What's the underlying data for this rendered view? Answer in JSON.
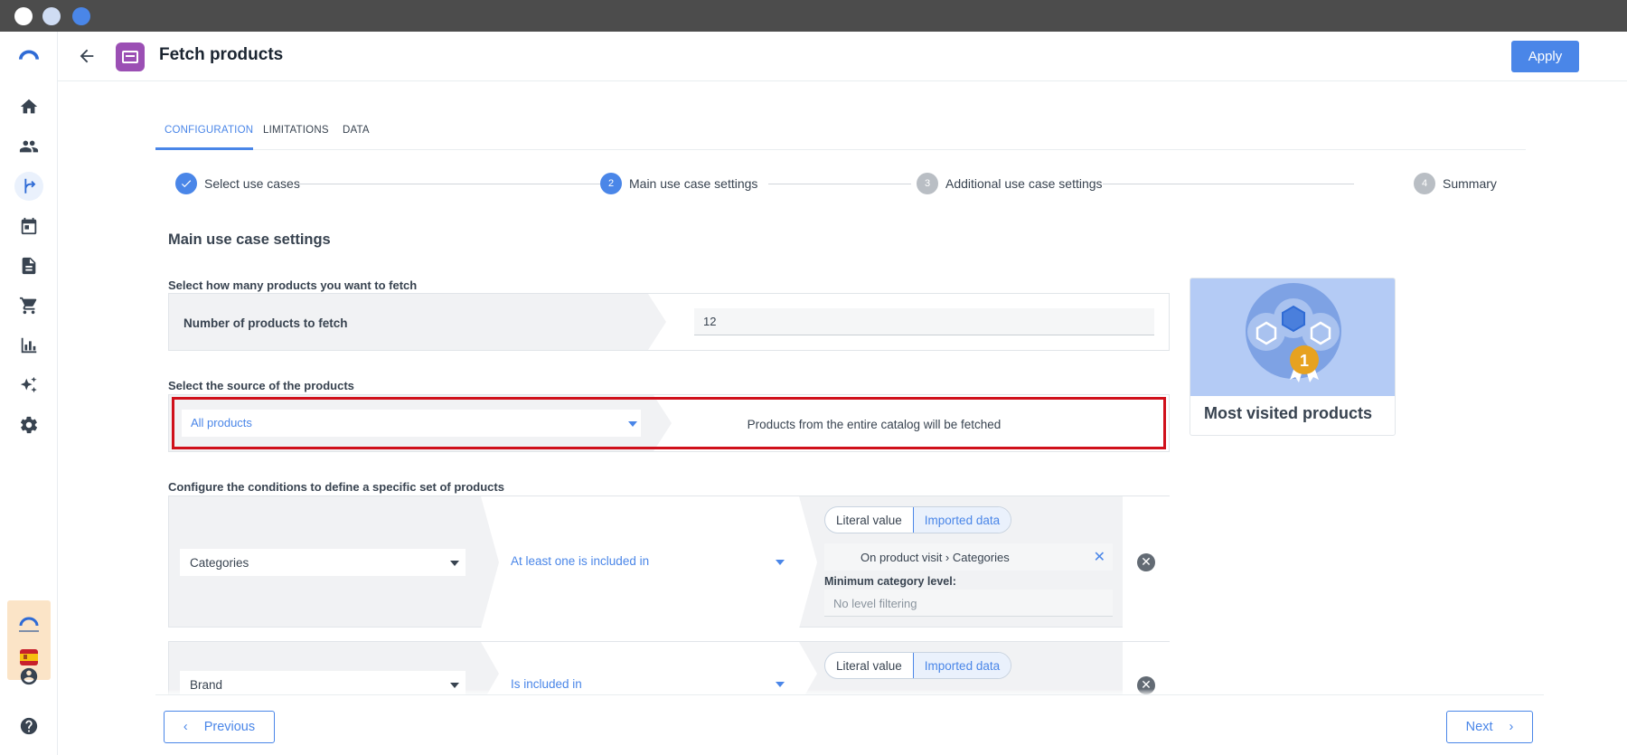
{
  "window": {
    "title": "Fetch products",
    "apply_label": "Apply"
  },
  "tabs": [
    {
      "label": "CONFIGURATION",
      "active": true
    },
    {
      "label": "LIMITATIONS",
      "active": false
    },
    {
      "label": "DATA",
      "active": false
    }
  ],
  "steps": [
    {
      "number": "✓",
      "label": "Select use cases",
      "state": "done"
    },
    {
      "number": "2",
      "label": "Main use case settings",
      "state": "active"
    },
    {
      "number": "3",
      "label": "Additional use case settings",
      "state": "pending"
    },
    {
      "number": "4",
      "label": "Summary",
      "state": "pending"
    }
  ],
  "section_title": "Main use case settings",
  "count": {
    "label": "Select how many products you want to fetch",
    "field_label": "Number of products to fetch",
    "value": "12"
  },
  "source": {
    "label": "Select the source of the products",
    "selected": "All products",
    "description": "Products from the entire catalog will be fetched"
  },
  "conditions": {
    "label": "Configure the conditions to define a specific set of products",
    "toggle_literal": "Literal value",
    "toggle_imported": "Imported data",
    "items": [
      {
        "attribute": "Categories",
        "operator": "At least one is included in",
        "value": "On product visit › Categories",
        "sub_label": "Minimum category level:",
        "level_placeholder": "No level filtering"
      },
      {
        "attribute": "Brand",
        "operator": "Is included in"
      }
    ]
  },
  "card": {
    "title": "Most visited products",
    "badge_number": "1"
  },
  "footer": {
    "previous_label": "Previous",
    "next_label": "Next"
  },
  "colors": {
    "accent": "#4a86e8",
    "highlight": "#d0101b",
    "node_icon": "#9b4fb4"
  }
}
